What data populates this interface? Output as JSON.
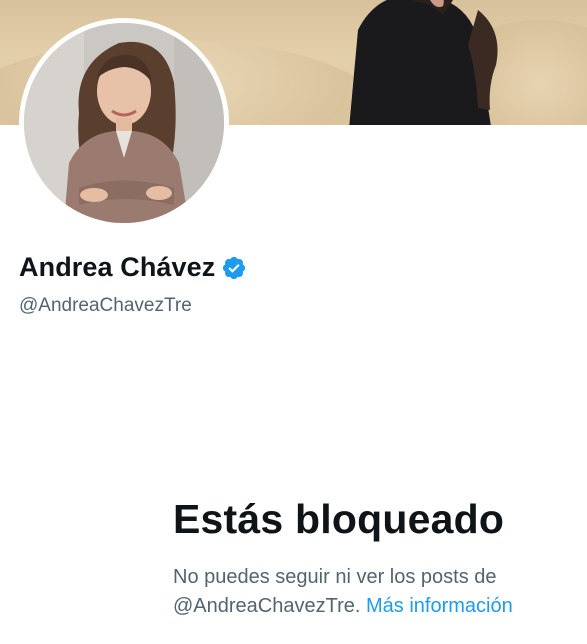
{
  "profile": {
    "display_name": "Andrea Chávez",
    "handle": "@AndreaChavezTre",
    "verified": true,
    "verified_color": "#1d9bf0"
  },
  "blocked": {
    "title": "Estás bloqueado",
    "message_prefix": "No puedes seguir ni ver los posts de",
    "message_handle": "@AndreaChavezTre.",
    "more_info_link": "Más información"
  },
  "colors": {
    "text_primary": "#0f1419",
    "text_secondary": "#536471",
    "link": "#1d9bf0"
  }
}
